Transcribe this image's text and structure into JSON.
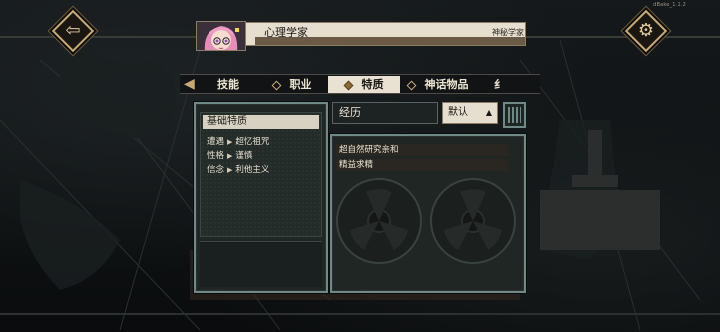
{
  "version": "dBake_1.1.2",
  "header": {
    "character_name": "心理学家",
    "character_title": "神秘学家"
  },
  "tabs": [
    {
      "label": "技能",
      "active": false
    },
    {
      "label": "职业",
      "active": false
    },
    {
      "label": "特质",
      "active": true
    },
    {
      "label": "神话物品",
      "active": false
    },
    {
      "label": "纟",
      "active": false
    }
  ],
  "basic_traits": {
    "title": "基础特质",
    "rows": [
      {
        "key": "遭遇",
        "value": "超忆祖咒"
      },
      {
        "key": "性格",
        "value": "谨慎"
      },
      {
        "key": "信念",
        "value": "利他主义"
      }
    ]
  },
  "experience": {
    "label": "经历",
    "sort_value": "默认",
    "items": [
      "超自然研究亲和",
      "精益求精"
    ]
  },
  "colors": {
    "accent_gold": "#c7a978",
    "panel_teal": "#6f8a86",
    "tab_active_bg": "#e9e2d2"
  },
  "icons": {
    "back": "back-arrow-icon",
    "settings": "gear-icon",
    "sort": "caret-up-icon"
  }
}
